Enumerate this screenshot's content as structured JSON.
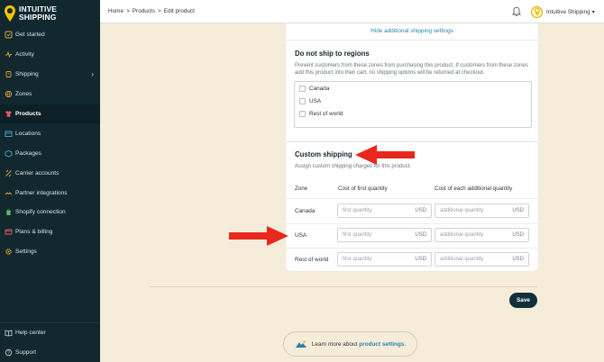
{
  "brand": {
    "line1": "INTUITIVE",
    "line2": "SHIPPING"
  },
  "sidebar": {
    "items": [
      {
        "label": "Get started",
        "icon": "rocket-icon"
      },
      {
        "label": "Activity",
        "icon": "activity-icon"
      },
      {
        "label": "Shipping",
        "icon": "shipping-icon"
      },
      {
        "label": "Zones",
        "icon": "zones-icon"
      },
      {
        "label": "Products",
        "icon": "shirt-icon"
      },
      {
        "label": "Locations",
        "icon": "location-icon"
      },
      {
        "label": "Packages",
        "icon": "package-icon"
      },
      {
        "label": "Carrier accounts",
        "icon": "carrier-icon"
      },
      {
        "label": "Partner integrations",
        "icon": "integrations-icon"
      },
      {
        "label": "Shopify connection",
        "icon": "shopify-icon"
      },
      {
        "label": "Plans & billing",
        "icon": "billing-icon"
      },
      {
        "label": "Settings",
        "icon": "gear-icon"
      }
    ],
    "bottom": [
      {
        "label": "Help center",
        "icon": "book-icon"
      },
      {
        "label": "Support",
        "icon": "help-icon"
      }
    ],
    "active": "Products"
  },
  "topbar": {
    "breadcrumb": [
      "Home",
      ">",
      "Products",
      ">",
      "Edit product"
    ],
    "profile_name": "Intuitive Shipping"
  },
  "card": {
    "hide_link": "Hide additional shipping settings",
    "do_not_ship": {
      "title": "Do not ship to regions",
      "description": "Prevent customers from these zones from purchasing this product. If customers from these zones add this product into their cart, no shipping options will be returned at checkout.",
      "regions": [
        "Canada",
        "USA",
        "Rest of world"
      ]
    },
    "custom_shipping": {
      "title": "Custom shipping",
      "description": "Assign custom shipping charges for this product.",
      "columns": [
        "Zone",
        "Cost of first quantity",
        "Cost of each additional quantity"
      ],
      "rows": [
        {
          "zone": "Canada",
          "first_placeholder": "first quantity",
          "additional_placeholder": "additional quantity",
          "unit": "USD"
        },
        {
          "zone": "USA",
          "first_placeholder": "first quantity",
          "additional_placeholder": "additional quantity",
          "unit": "USD"
        },
        {
          "zone": "Rest of world",
          "first_placeholder": "first quantity",
          "additional_placeholder": "additional quantity",
          "unit": "USD"
        }
      ]
    }
  },
  "save_label": "Save",
  "learn_more": {
    "text": "Learn more about",
    "link": "product settings",
    "suffix": "."
  },
  "colors": {
    "sidebar_bg": "#11282e",
    "page_bg": "#f5ecda",
    "accent": "#12303a",
    "link": "#2a84a8",
    "arrow": "#e8271e",
    "logo": "#f2c200"
  }
}
